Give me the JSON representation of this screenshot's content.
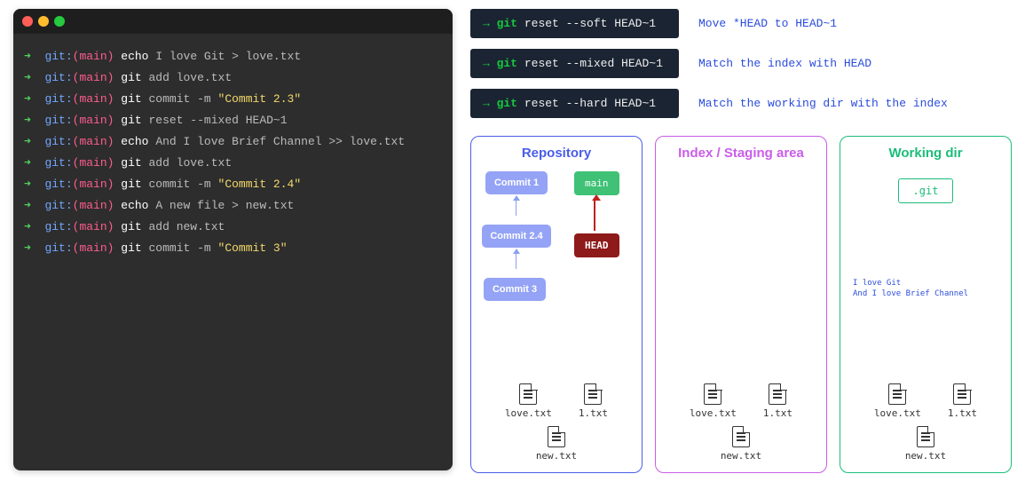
{
  "terminal": {
    "lines": [
      {
        "cmd": "echo",
        "args": "I love Git > love.txt"
      },
      {
        "cmd": "git",
        "args": "add love.txt"
      },
      {
        "cmd": "git",
        "args": "commit -m ",
        "str": "\"Commit 2.3\""
      },
      {
        "cmd": "git",
        "args": "reset --mixed HEAD~1"
      },
      {
        "cmd": "echo",
        "args": "And I love Brief Channel >> love.txt"
      },
      {
        "cmd": "git",
        "args": "add love.txt"
      },
      {
        "cmd": "git",
        "args": "commit -m ",
        "str": "\"Commit 2.4\""
      },
      {
        "cmd": "echo",
        "args": "A new file > new.txt"
      },
      {
        "cmd": "git",
        "args": "add new.txt"
      },
      {
        "cmd": "git",
        "args": "commit -m ",
        "str": "\"Commit 3\""
      }
    ],
    "prompt_arrow": "➜",
    "prompt_git": "git:",
    "prompt_branch": "(main)"
  },
  "reset_commands": [
    {
      "suffix": "reset --soft HEAD~1",
      "desc": "Move *HEAD to HEAD~1"
    },
    {
      "suffix": "reset --mixed HEAD~1",
      "desc": "Match the index with HEAD"
    },
    {
      "suffix": "reset --hard HEAD~1",
      "desc": "Match the working dir with the index"
    }
  ],
  "reset_prefix_arrow": "→",
  "reset_prefix_git": "git",
  "panels": {
    "repo": {
      "title": "Repository",
      "commits": {
        "c1": "Commit 1",
        "c24": "Commit 2.4",
        "c3": "Commit 3"
      },
      "branch_label": "main",
      "head_label": "HEAD",
      "files": [
        "love.txt",
        "1.txt",
        "new.txt"
      ]
    },
    "index": {
      "title": "Index / Staging area",
      "files": [
        "love.txt",
        "1.txt",
        "new.txt"
      ]
    },
    "work": {
      "title": "Working dir",
      "folder": ".git",
      "text_lines": "I love Git\nAnd I love Brief Channel",
      "files": [
        "love.txt",
        "1.txt",
        "new.txt"
      ]
    }
  }
}
